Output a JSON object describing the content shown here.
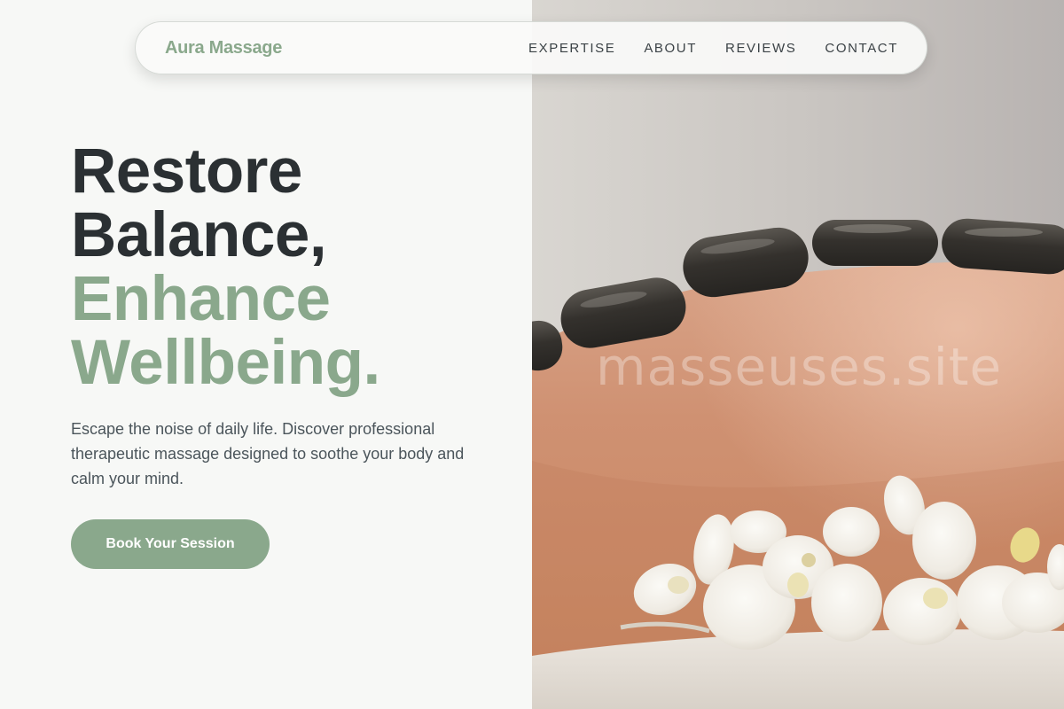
{
  "brand": {
    "name": "Aura Massage",
    "accent_color": "#8aa88c",
    "text_dark": "#2b3033"
  },
  "nav": {
    "items": [
      {
        "label": "EXPERTISE"
      },
      {
        "label": "ABOUT"
      },
      {
        "label": "REVIEWS"
      },
      {
        "label": "CONTACT"
      }
    ]
  },
  "hero": {
    "headline_line1": "Restore",
    "headline_line2": "Balance,",
    "headline_line3": "Enhance",
    "headline_line4": "Wellbeing.",
    "description": "Escape the noise of daily life. Discover professional therapeutic massage designed to soothe your body and calm your mind.",
    "cta_label": "Book Your Session"
  },
  "hero_image": {
    "watermark": "masseuses.site"
  }
}
